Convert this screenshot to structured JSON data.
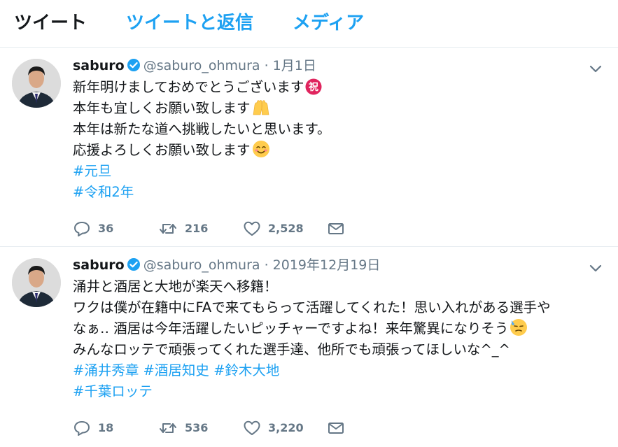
{
  "tabs": [
    {
      "label": "ツイート",
      "active": true
    },
    {
      "label": "ツイートと返信",
      "active": false
    },
    {
      "label": "メディア",
      "active": false
    }
  ],
  "colors": {
    "accent": "#1da1f2",
    "muted": "#657786",
    "text": "#14171a",
    "border": "#e6ecf0"
  },
  "tweets": [
    {
      "name": "saburo",
      "handle": "@saburo_ohmura",
      "separator": "·",
      "date": "1月1日",
      "lines": [
        {
          "text": "新年明けましておめでとうございます",
          "emoji": "celebration-kanji-emoji"
        },
        {
          "text": "本年も宜しくお願い致します",
          "emoji": "raised-hands-emoji"
        },
        {
          "text": "本年は新たな道へ挑戦したいと思います。"
        },
        {
          "text": "応援よろしくお願い致します",
          "emoji": "smiling-face-emoji"
        }
      ],
      "hashtags": [
        "#元旦",
        "#令和2年"
      ],
      "replies": "36",
      "retweets": "216",
      "likes": "2,528"
    },
    {
      "name": "saburo",
      "handle": "@saburo_ohmura",
      "separator": "·",
      "date": "2019年12月19日",
      "lines": [
        {
          "text": "涌井と酒居と大地が楽天へ移籍！"
        },
        {
          "text": "ワクは僕が在籍中にFAで来てもらって活躍してくれた！思い入れがある選手や"
        },
        {
          "text": "なぁ‥ 酒居は今年活躍したいピッチャーですよね！来年驚異になりそう",
          "emoji": "sweat-face-emoji"
        },
        {
          "text": "みんなロッテで頑張ってくれた選手達、他所でも頑張ってほしいな^_^"
        }
      ],
      "hashtag_line": [
        "#涌井秀章",
        "#酒居知史",
        "#鈴木大地"
      ],
      "hashtags": [
        "#千葉ロッテ"
      ],
      "replies": "18",
      "retweets": "536",
      "likes": "3,220"
    }
  ]
}
